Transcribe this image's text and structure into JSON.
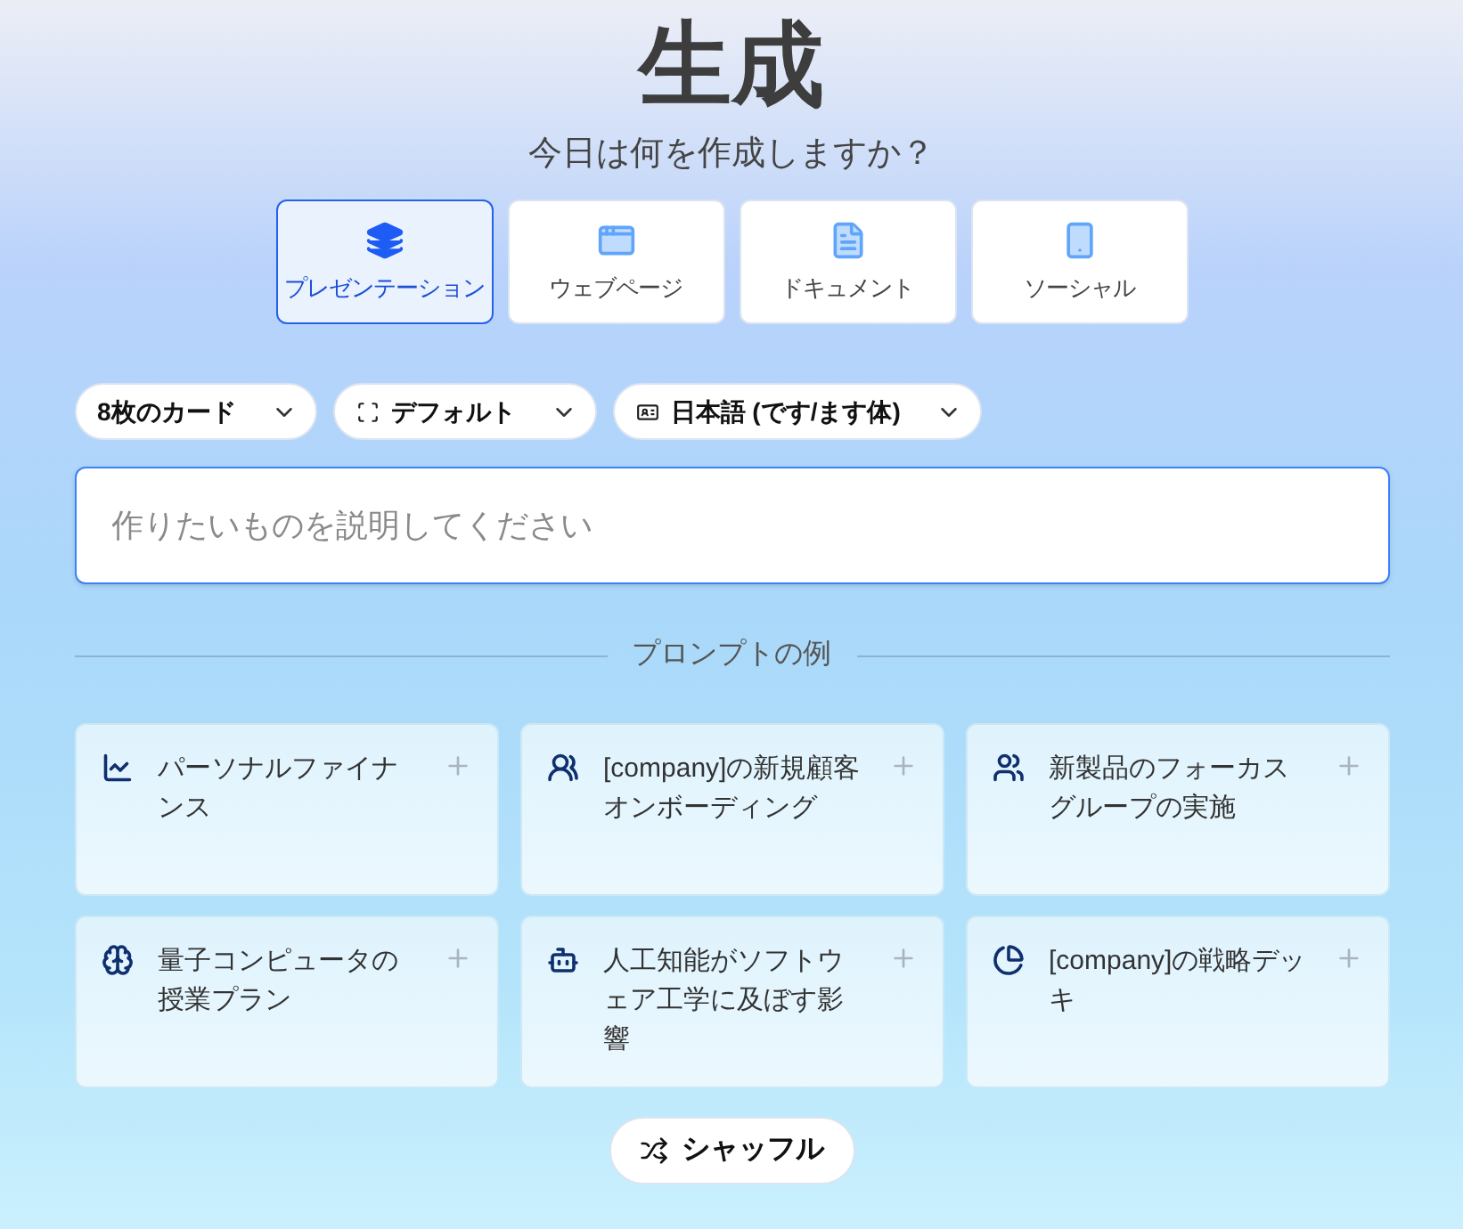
{
  "title": "生成",
  "subtitle": "今日は何を作成しますか？",
  "tabs": [
    {
      "label": "プレゼンテーション",
      "kind": "presentation",
      "selected": true
    },
    {
      "label": "ウェブページ",
      "kind": "webpage",
      "selected": false
    },
    {
      "label": "ドキュメント",
      "kind": "document",
      "selected": false
    },
    {
      "label": "ソーシャル",
      "kind": "social",
      "selected": false
    }
  ],
  "options": [
    {
      "label": "8枚のカード",
      "kind": "cards"
    },
    {
      "label": "デフォルト",
      "kind": "layout"
    },
    {
      "label": "日本語 (です/ます体)",
      "kind": "language"
    }
  ],
  "prompt_field": {
    "placeholder": "作りたいものを説明してください"
  },
  "examples_heading": "プロンプトの例",
  "examples": [
    {
      "text": "パーソナルファイナンス",
      "kind": "chart"
    },
    {
      "text": "[company]の新規顧客オンボーディング",
      "kind": "team"
    },
    {
      "text": "新製品のフォーカスグループの実施",
      "kind": "group"
    },
    {
      "text": "量子コンピュータの授業プラン",
      "kind": "brain"
    },
    {
      "text": "人工知能がソフトウェア工学に及ぼす影響",
      "kind": "robot"
    },
    {
      "text": "[company]の戦略デッキ",
      "kind": "pie"
    }
  ],
  "shuffle_button": "シャッフル"
}
